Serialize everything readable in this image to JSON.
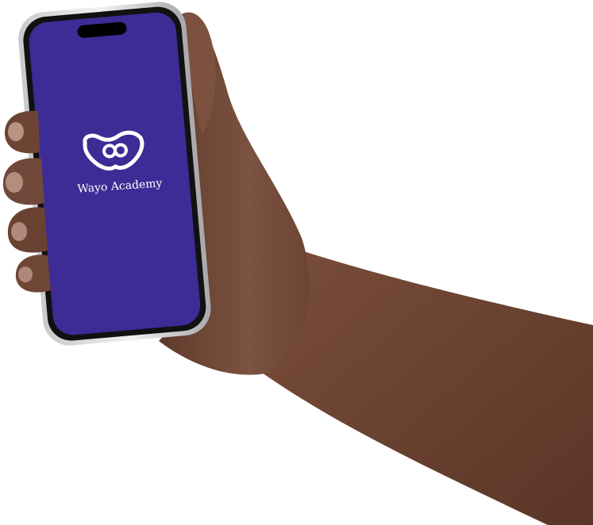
{
  "app": {
    "name": "Wayo Academy",
    "logo_icon": "wayo-w-logo-icon"
  },
  "colors": {
    "screen_background": "#3d2b96",
    "logo_foreground": "#ffffff",
    "skin": "#6e4634",
    "phone_frame": "#1a1a1a",
    "page_background": "#ffffff"
  }
}
